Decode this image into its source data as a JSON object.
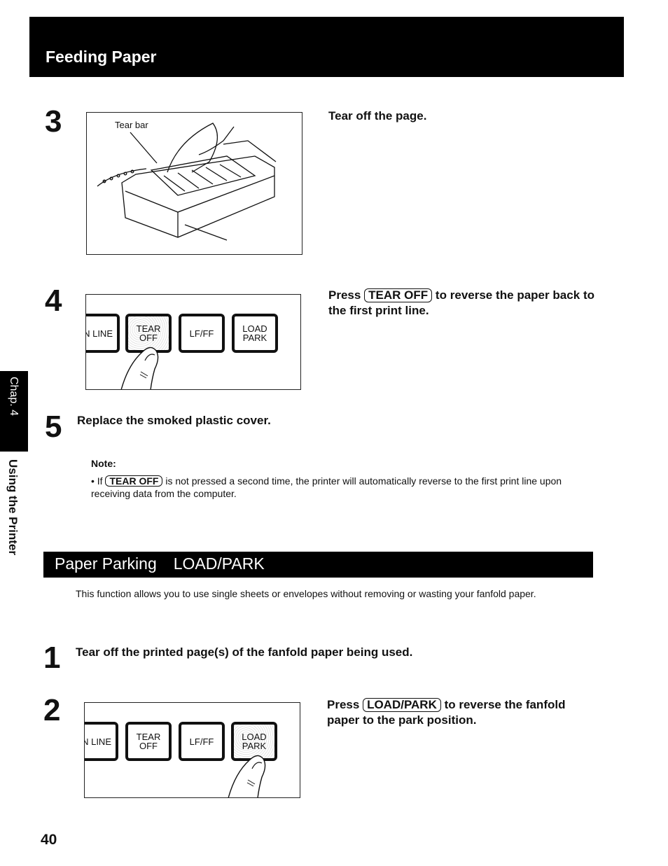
{
  "header": {
    "title": "Feeding Paper"
  },
  "side_tab": {
    "chapter": "Chap. 4",
    "section": "Using the Printer"
  },
  "feeding_steps": [
    {
      "number": "3",
      "figure_label": "Tear bar",
      "text": "Tear off the page."
    },
    {
      "number": "4",
      "text_prefix": "Press",
      "key": "TEAR OFF",
      "text_suffix": "to reverse the paper back to the first print line.",
      "panel_keys": [
        {
          "line1": "N LINE",
          "line2": "",
          "pressed": false
        },
        {
          "line1": "TEAR",
          "line2": "OFF",
          "pressed": true
        },
        {
          "line1": "LF/FF",
          "line2": "",
          "pressed": false
        },
        {
          "line1": "LOAD",
          "line2": "PARK",
          "pressed": false
        }
      ]
    },
    {
      "number": "5",
      "text": "Replace the smoked plastic cover."
    }
  ],
  "note": {
    "label": "Note:",
    "bullet_prefix": "If",
    "key": "TEAR OFF",
    "bullet_text": "is not pressed a second time, the printer will automatically reverse to the first print line upon receiving data from the computer."
  },
  "section": {
    "title_main": "Paper Parking",
    "title_key": "LOAD/PARK",
    "intro": "This function allows you to use single sheets or envelopes without removing or wasting your fanfold paper."
  },
  "parking_steps": [
    {
      "number": "1",
      "text": "Tear off the printed page(s) of the fanfold paper being used."
    },
    {
      "number": "2",
      "text_prefix": "Press",
      "key": "LOAD/PARK",
      "text_suffix": "to reverse the fanfold paper to the park position.",
      "panel_keys": [
        {
          "line1": "N LINE",
          "line2": "",
          "pressed": false
        },
        {
          "line1": "TEAR",
          "line2": "OFF",
          "pressed": false
        },
        {
          "line1": "LF/FF",
          "line2": "",
          "pressed": false
        },
        {
          "line1": "LOAD",
          "line2": "PARK",
          "pressed": true
        }
      ]
    }
  ],
  "footer": {
    "page_number": "40"
  }
}
